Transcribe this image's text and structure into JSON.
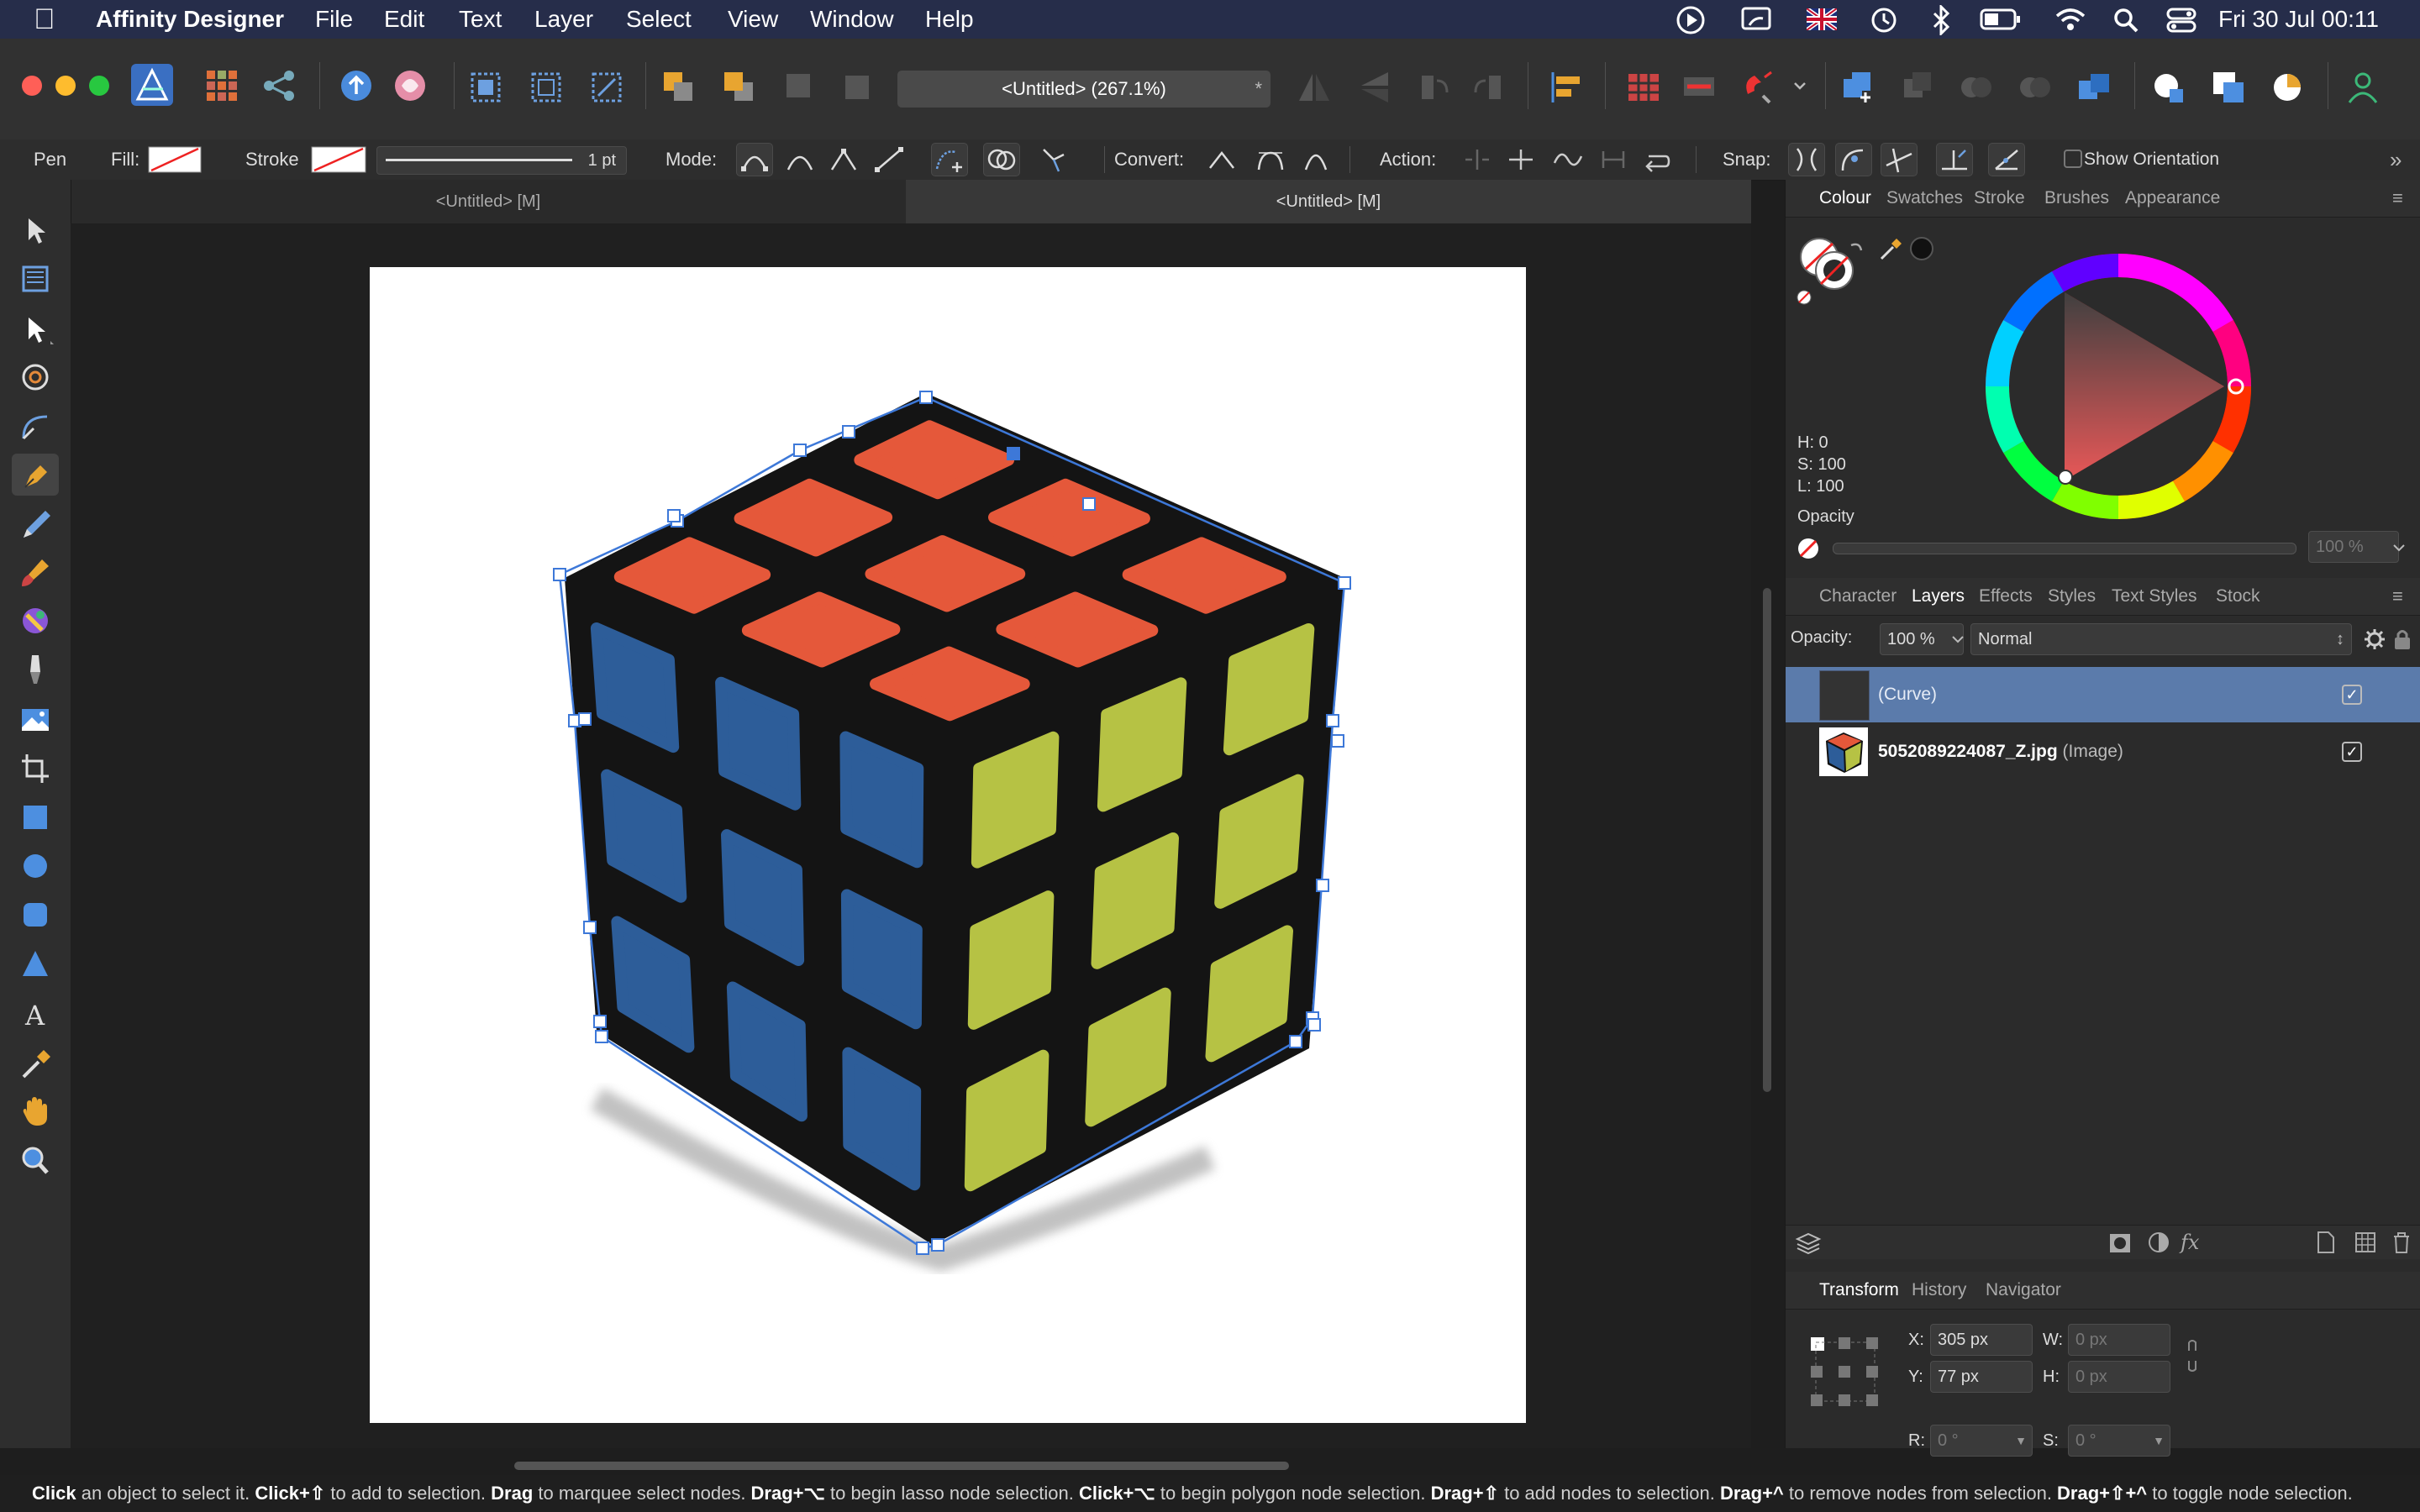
{
  "menubar": {
    "app_name": "Affinity Designer",
    "items": [
      "File",
      "Edit",
      "Text",
      "Layer",
      "Select",
      "View",
      "Window",
      "Help"
    ],
    "clock": "Fri 30 Jul  00:11"
  },
  "toolbar": {
    "doc_title": "<Untitled> (267.1%)",
    "modified_star": "*"
  },
  "context_bar": {
    "tool_name": "Pen",
    "fill_label": "Fill:",
    "stroke_label": "Stroke",
    "stroke_width": "1 pt",
    "mode_label": "Mode:",
    "convert_label": "Convert:",
    "action_label": "Action:",
    "snap_label": "Snap:",
    "show_orientation": "Show Orientation"
  },
  "doc_tabs": [
    "<Untitled> [M]",
    "<Untitled> [M]"
  ],
  "colour_panel": {
    "tabs": [
      "Colour",
      "Swatches",
      "Stroke",
      "Brushes",
      "Appearance"
    ],
    "active_tab": "Colour",
    "h": "H: 0",
    "s": "S: 100",
    "l": "L: 100",
    "opacity_label": "Opacity",
    "opacity_value": "100 %"
  },
  "layers_panel": {
    "tabs": [
      "Character",
      "Layers",
      "Effects",
      "Styles",
      "Text Styles",
      "Stock"
    ],
    "active_tab": "Layers",
    "opacity_label": "Opacity:",
    "opacity_value": "100 %",
    "blend_mode": "Normal",
    "layers": [
      {
        "name": "(Curve)",
        "type": "",
        "selected": true,
        "visible": true
      },
      {
        "name": "5052089224087_Z.jpg",
        "type": "(Image)",
        "selected": false,
        "visible": true
      }
    ]
  },
  "transform_panel": {
    "tabs": [
      "Transform",
      "History",
      "Navigator"
    ],
    "active_tab": "Transform",
    "x_label": "X:",
    "x_value": "305 px",
    "y_label": "Y:",
    "y_value": "77 px",
    "w_label": "W:",
    "w_value": "0 px",
    "h_label": "H:",
    "h_value": "0 px",
    "r_label": "R:",
    "r_value": "0 °",
    "s_label": "S:",
    "s_value": "0 °"
  },
  "status_bar": {
    "segments": [
      {
        "b": "Click",
        "t": " an object to select it. "
      },
      {
        "b": "Click+⇧",
        "t": " to add to selection. "
      },
      {
        "b": "Drag",
        "t": " to marquee select nodes. "
      },
      {
        "b": "Drag+⌥",
        "t": " to begin lasso node selection. "
      },
      {
        "b": "Click+⌥",
        "t": " to begin polygon node selection. "
      },
      {
        "b": "Drag+⇧",
        "t": " to add nodes to selection. "
      },
      {
        "b": "Drag+^",
        "t": " to remove nodes from selection. "
      },
      {
        "b": "Drag+⇧+^",
        "t": " to toggle node selection."
      }
    ]
  },
  "colors": {
    "cube_red": "#e5583a",
    "cube_blue": "#2d5d99",
    "cube_yellow": "#b6c244",
    "selection_blue": "#3d78d8",
    "layer_selected": "#5b7bab"
  }
}
